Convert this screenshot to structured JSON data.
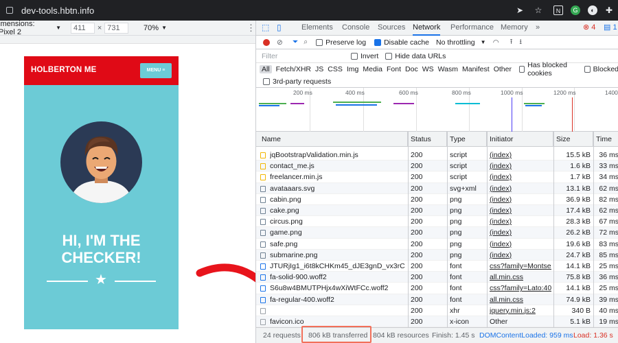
{
  "browser": {
    "url": "dev-tools.hbtn.info"
  },
  "device_toolbar": {
    "label": "imensions: Pixel 2",
    "width": "411",
    "times": "×",
    "height": "731",
    "zoom": "70%"
  },
  "site": {
    "brand": "HOLBERTON ME",
    "menu_label": "MENU ≡",
    "hero_title_1": "HI, I'M THE",
    "hero_title_2": "CHECKER!",
    "star": "★",
    "colors": {
      "header": "#e00a16",
      "body": "#6ccbd6"
    }
  },
  "devtools": {
    "tabs": [
      "Elements",
      "Console",
      "Sources",
      "Network",
      "Performance",
      "Memory"
    ],
    "more_tabs": "»",
    "selected_tab": "Network",
    "error_count": "4",
    "message_count": "1",
    "toolbar": {
      "preserve_log": "Preserve log",
      "disable_cache": "Disable cache",
      "throttling": "No throttling"
    },
    "filter": {
      "placeholder": "Filter",
      "invert": "Invert",
      "hide_data_urls": "Hide data URLs"
    },
    "types": [
      "All",
      "Fetch/XHR",
      "JS",
      "CSS",
      "Img",
      "Media",
      "Font",
      "Doc",
      "WS",
      "Wasm",
      "Manifest",
      "Other"
    ],
    "has_blocked_cookies": "Has blocked cookies",
    "blocked": "Blocked",
    "third_party": "3rd-party requests",
    "timeline_ticks": [
      "200 ms",
      "400 ms",
      "600 ms",
      "800 ms",
      "1000 ms",
      "1200 ms",
      "1400"
    ],
    "columns": [
      "Name",
      "Status",
      "Type",
      "Initiator",
      "Size",
      "Time"
    ],
    "rows": [
      {
        "name": "jqBootstrapValidation.min.js",
        "status": "200",
        "type": "script",
        "initiator": "(index)",
        "size": "15.5 kB",
        "time": "36 ms"
      },
      {
        "name": "contact_me.js",
        "status": "200",
        "type": "script",
        "initiator": "(index)",
        "size": "1.6 kB",
        "time": "33 ms"
      },
      {
        "name": "freelancer.min.js",
        "status": "200",
        "type": "script",
        "initiator": "(index)",
        "size": "1.7 kB",
        "time": "34 ms"
      },
      {
        "name": "avataaars.svg",
        "status": "200",
        "type": "svg+xml",
        "initiator": "(index)",
        "size": "13.1 kB",
        "time": "62 ms"
      },
      {
        "name": "cabin.png",
        "status": "200",
        "type": "png",
        "initiator": "(index)",
        "size": "36.9 kB",
        "time": "82 ms"
      },
      {
        "name": "cake.png",
        "status": "200",
        "type": "png",
        "initiator": "(index)",
        "size": "17.4 kB",
        "time": "62 ms"
      },
      {
        "name": "circus.png",
        "status": "200",
        "type": "png",
        "initiator": "(index)",
        "size": "28.3 kB",
        "time": "67 ms"
      },
      {
        "name": "game.png",
        "status": "200",
        "type": "png",
        "initiator": "(index)",
        "size": "26.2 kB",
        "time": "72 ms"
      },
      {
        "name": "safe.png",
        "status": "200",
        "type": "png",
        "initiator": "(index)",
        "size": "19.6 kB",
        "time": "83 ms"
      },
      {
        "name": "submarine.png",
        "status": "200",
        "type": "png",
        "initiator": "(index)",
        "size": "24.7 kB",
        "time": "85 ms"
      },
      {
        "name": "JTURjIg1_i6t8kCHKm45_dJE3gnD_vx3rCs....",
        "status": "200",
        "type": "font",
        "initiator": "css?family=Montse...",
        "size": "14.1 kB",
        "time": "25 ms"
      },
      {
        "name": "fa-solid-900.woff2",
        "status": "200",
        "type": "font",
        "initiator": "all.min.css",
        "size": "75.8 kB",
        "time": "36 ms"
      },
      {
        "name": "S6u8w4BMUTPHjx4wXiWtFCc.woff2",
        "status": "200",
        "type": "font",
        "initiator": "css?family=Lato:40...",
        "size": "14.1 kB",
        "time": "25 ms"
      },
      {
        "name": "fa-regular-400.woff2",
        "status": "200",
        "type": "font",
        "initiator": "all.min.css",
        "size": "74.9 kB",
        "time": "39 ms"
      },
      {
        "name": "",
        "status": "200",
        "type": "xhr",
        "initiator": "jquery.min.js:2",
        "size": "340 B",
        "time": "40 ms"
      },
      {
        "name": "favicon.ico",
        "status": "200",
        "type": "x-icon",
        "initiator": "Other",
        "size": "5.1 kB",
        "time": "19 ms"
      }
    ],
    "status_bar": {
      "requests": "24 requests",
      "transferred": "806 kB transferred",
      "resources": "804 kB resources",
      "finish": "Finish: 1.45 s",
      "dom_loaded": "DOMContentLoaded: 959 ms",
      "load": "Load: 1.36 s"
    }
  }
}
